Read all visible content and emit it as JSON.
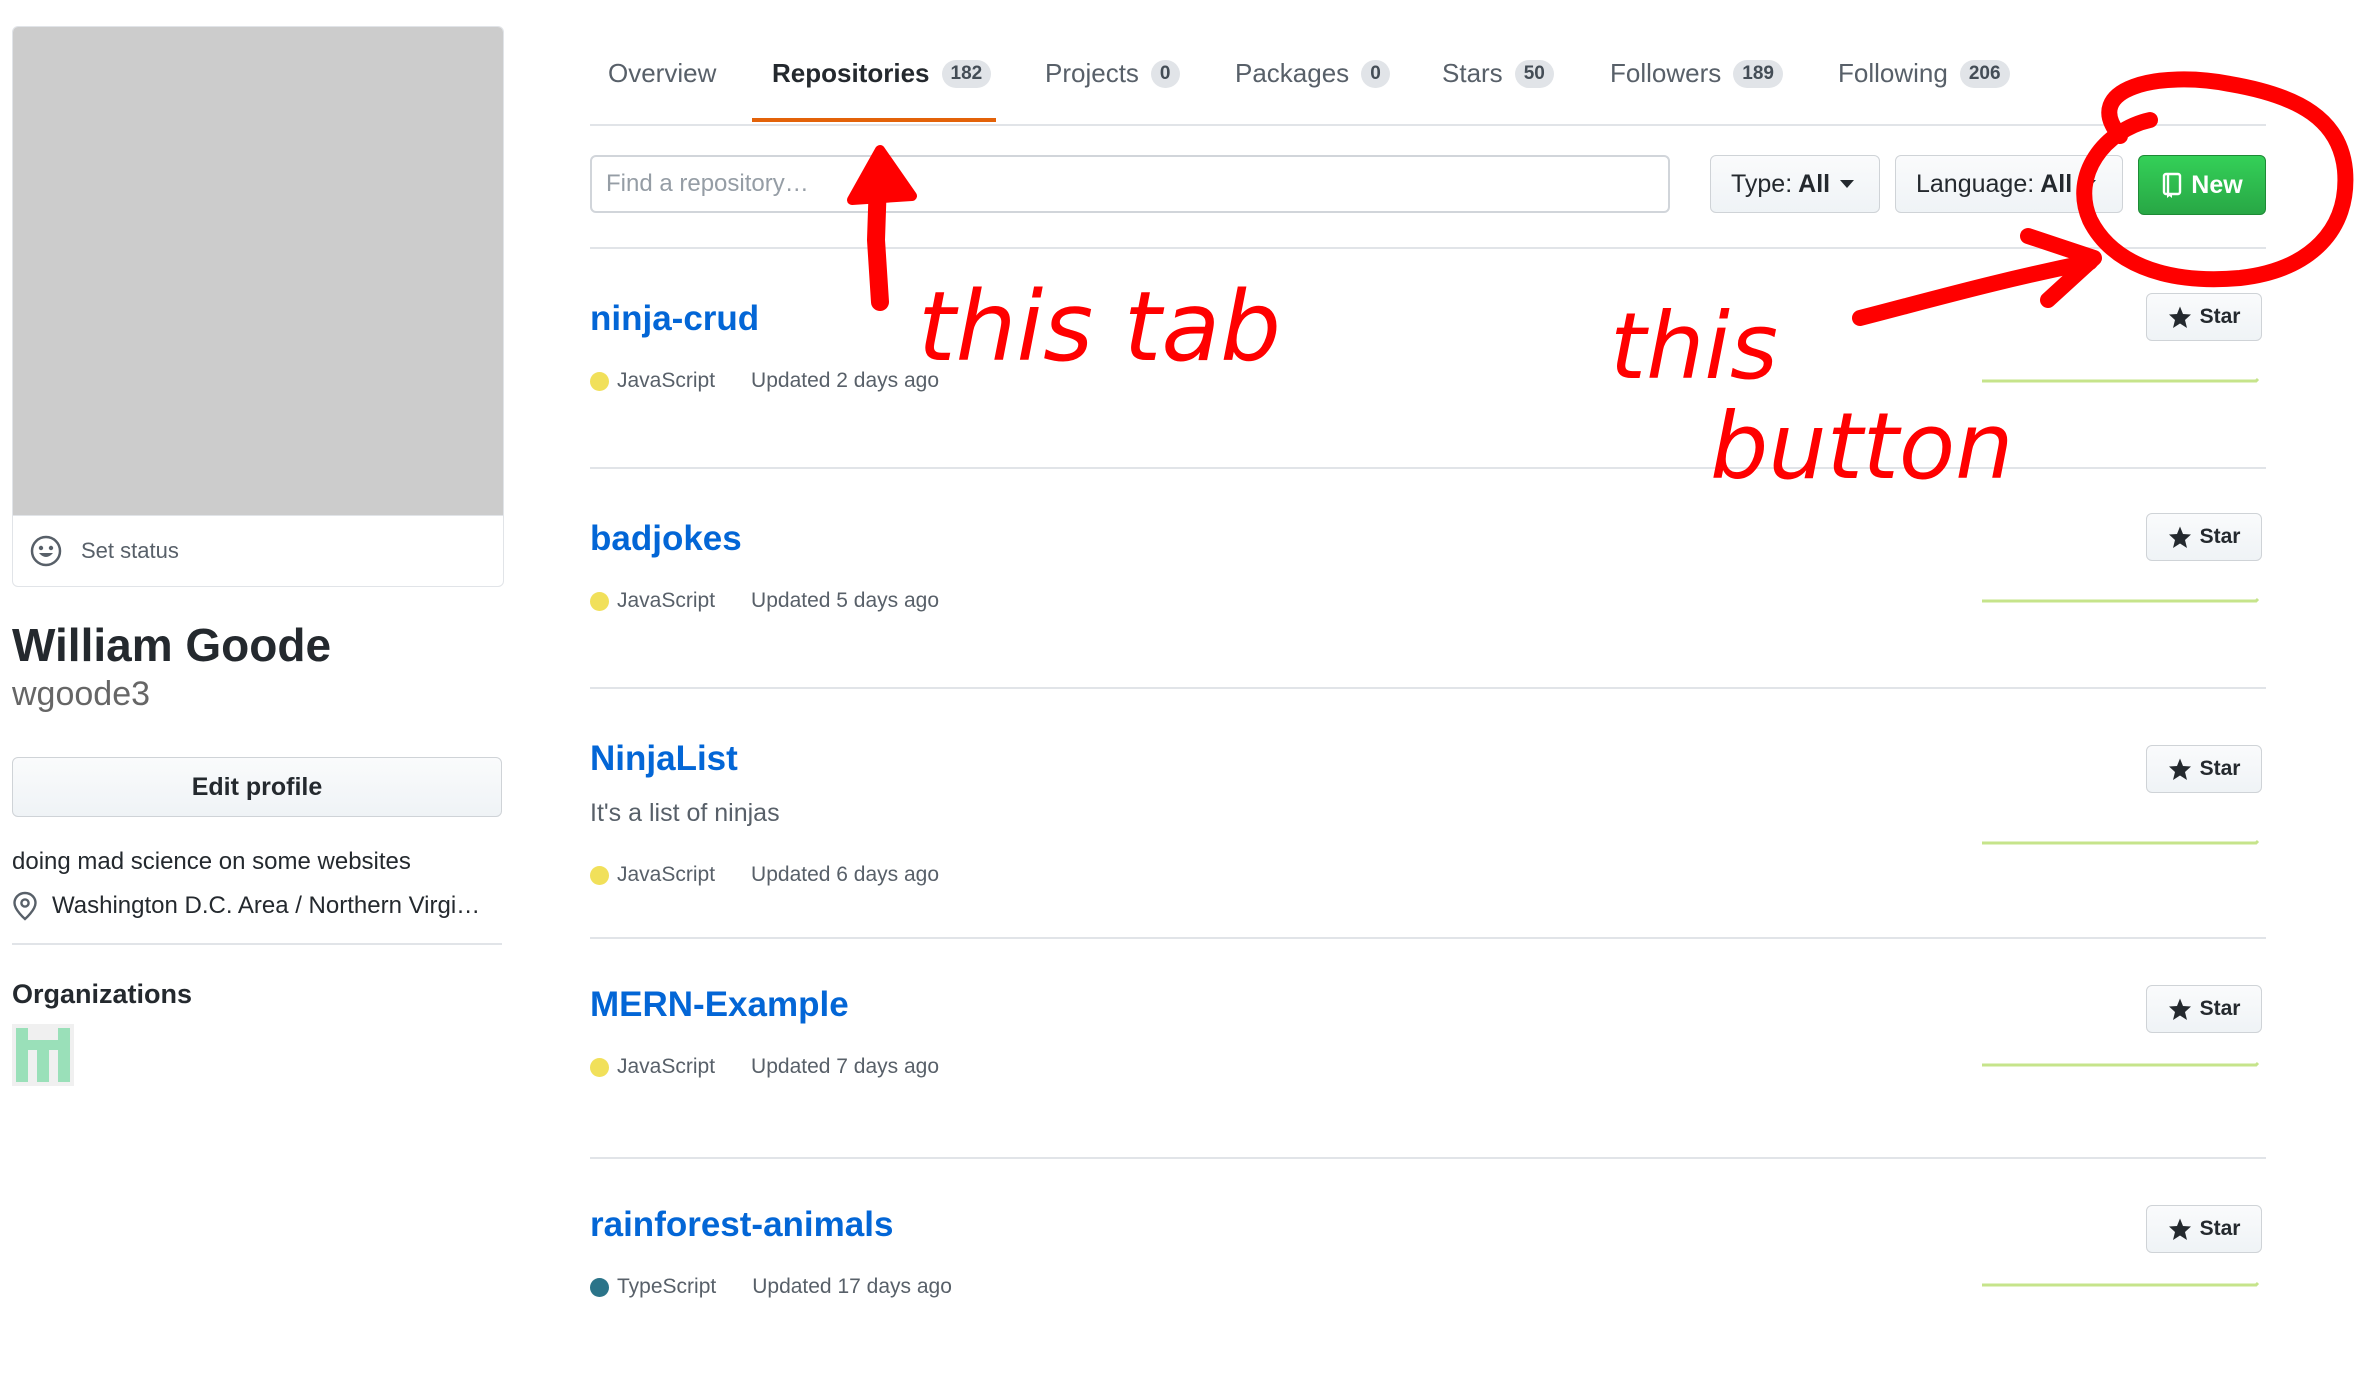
{
  "profile": {
    "set_status_label": "Set status",
    "full_name": "William Goode",
    "username": "wgoode3",
    "edit_profile_label": "Edit profile",
    "bio": "doing mad science on some websites",
    "location": "Washington D.C. Area / Northern Virgi…",
    "organizations_title": "Organizations"
  },
  "tabs": [
    {
      "label": "Overview",
      "count": ""
    },
    {
      "label": "Repositories",
      "count": "182"
    },
    {
      "label": "Projects",
      "count": "0"
    },
    {
      "label": "Packages",
      "count": "0"
    },
    {
      "label": "Stars",
      "count": "50"
    },
    {
      "label": "Followers",
      "count": "189"
    },
    {
      "label": "Following",
      "count": "206"
    }
  ],
  "active_tab": "Repositories",
  "filters": {
    "search_placeholder": "Find a repository…",
    "type_label": "Type:",
    "type_value": "All",
    "language_label": "Language:",
    "language_value": "All",
    "new_label": "New"
  },
  "repos": [
    {
      "name": "ninja-crud",
      "description": "",
      "language": "JavaScript",
      "language_color": "#f1e05a",
      "updated": "Updated 2 days ago",
      "star_label": "Star"
    },
    {
      "name": "badjokes",
      "description": "",
      "language": "JavaScript",
      "language_color": "#f1e05a",
      "updated": "Updated 5 days ago",
      "star_label": "Star"
    },
    {
      "name": "NinjaList",
      "description": "It's a list of ninjas",
      "language": "JavaScript",
      "language_color": "#f1e05a",
      "updated": "Updated 6 days ago",
      "star_label": "Star"
    },
    {
      "name": "MERN-Example",
      "description": "",
      "language": "JavaScript",
      "language_color": "#f1e05a",
      "updated": "Updated 7 days ago",
      "star_label": "Star"
    },
    {
      "name": "rainforest-animals",
      "description": "",
      "language": "TypeScript",
      "language_color": "#2b7489",
      "updated": "Updated 17 days ago",
      "star_label": "Star"
    }
  ],
  "annotations": {
    "tab_note": "this tab",
    "button_note_line1": "this",
    "button_note_line2": "button",
    "color": "#ff0000"
  },
  "colors": {
    "link": "#0366d6",
    "tab_underline": "#e36209",
    "new_button": "#28a745",
    "avatar_placeholder": "#cccccc"
  }
}
